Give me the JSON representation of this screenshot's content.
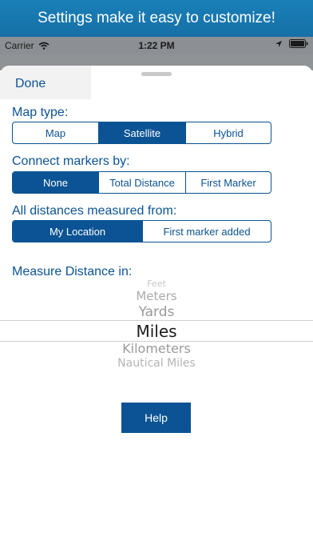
{
  "banner": {
    "text": "Settings make it easy to customize!"
  },
  "status_bar": {
    "carrier": "Carrier",
    "time": "1:22 PM",
    "icons": [
      "wifi-icon",
      "location-arrow-icon",
      "battery-icon"
    ]
  },
  "sheet": {
    "done_label": "Done",
    "map_type": {
      "label": "Map type:",
      "options": [
        "Map",
        "Satellite",
        "Hybrid"
      ],
      "selected": "Satellite"
    },
    "connect_markers": {
      "label": "Connect markers by:",
      "options": [
        "None",
        "Total Distance",
        "First Marker"
      ],
      "selected": "None"
    },
    "distances_from": {
      "label": "All distances measured from:",
      "options": [
        "My Location",
        "First marker added"
      ],
      "selected": "My Location"
    },
    "measure": {
      "label": "Measure Distance in:",
      "units": [
        "Feet",
        "Meters",
        "Yards",
        "Miles",
        "Kilometers",
        "Nautical Miles"
      ],
      "selected": "Miles"
    },
    "help_label": "Help"
  },
  "colors": {
    "accent": "#0b5394",
    "banner": "#1a7fb8",
    "status_bar": "#8c8f93"
  }
}
